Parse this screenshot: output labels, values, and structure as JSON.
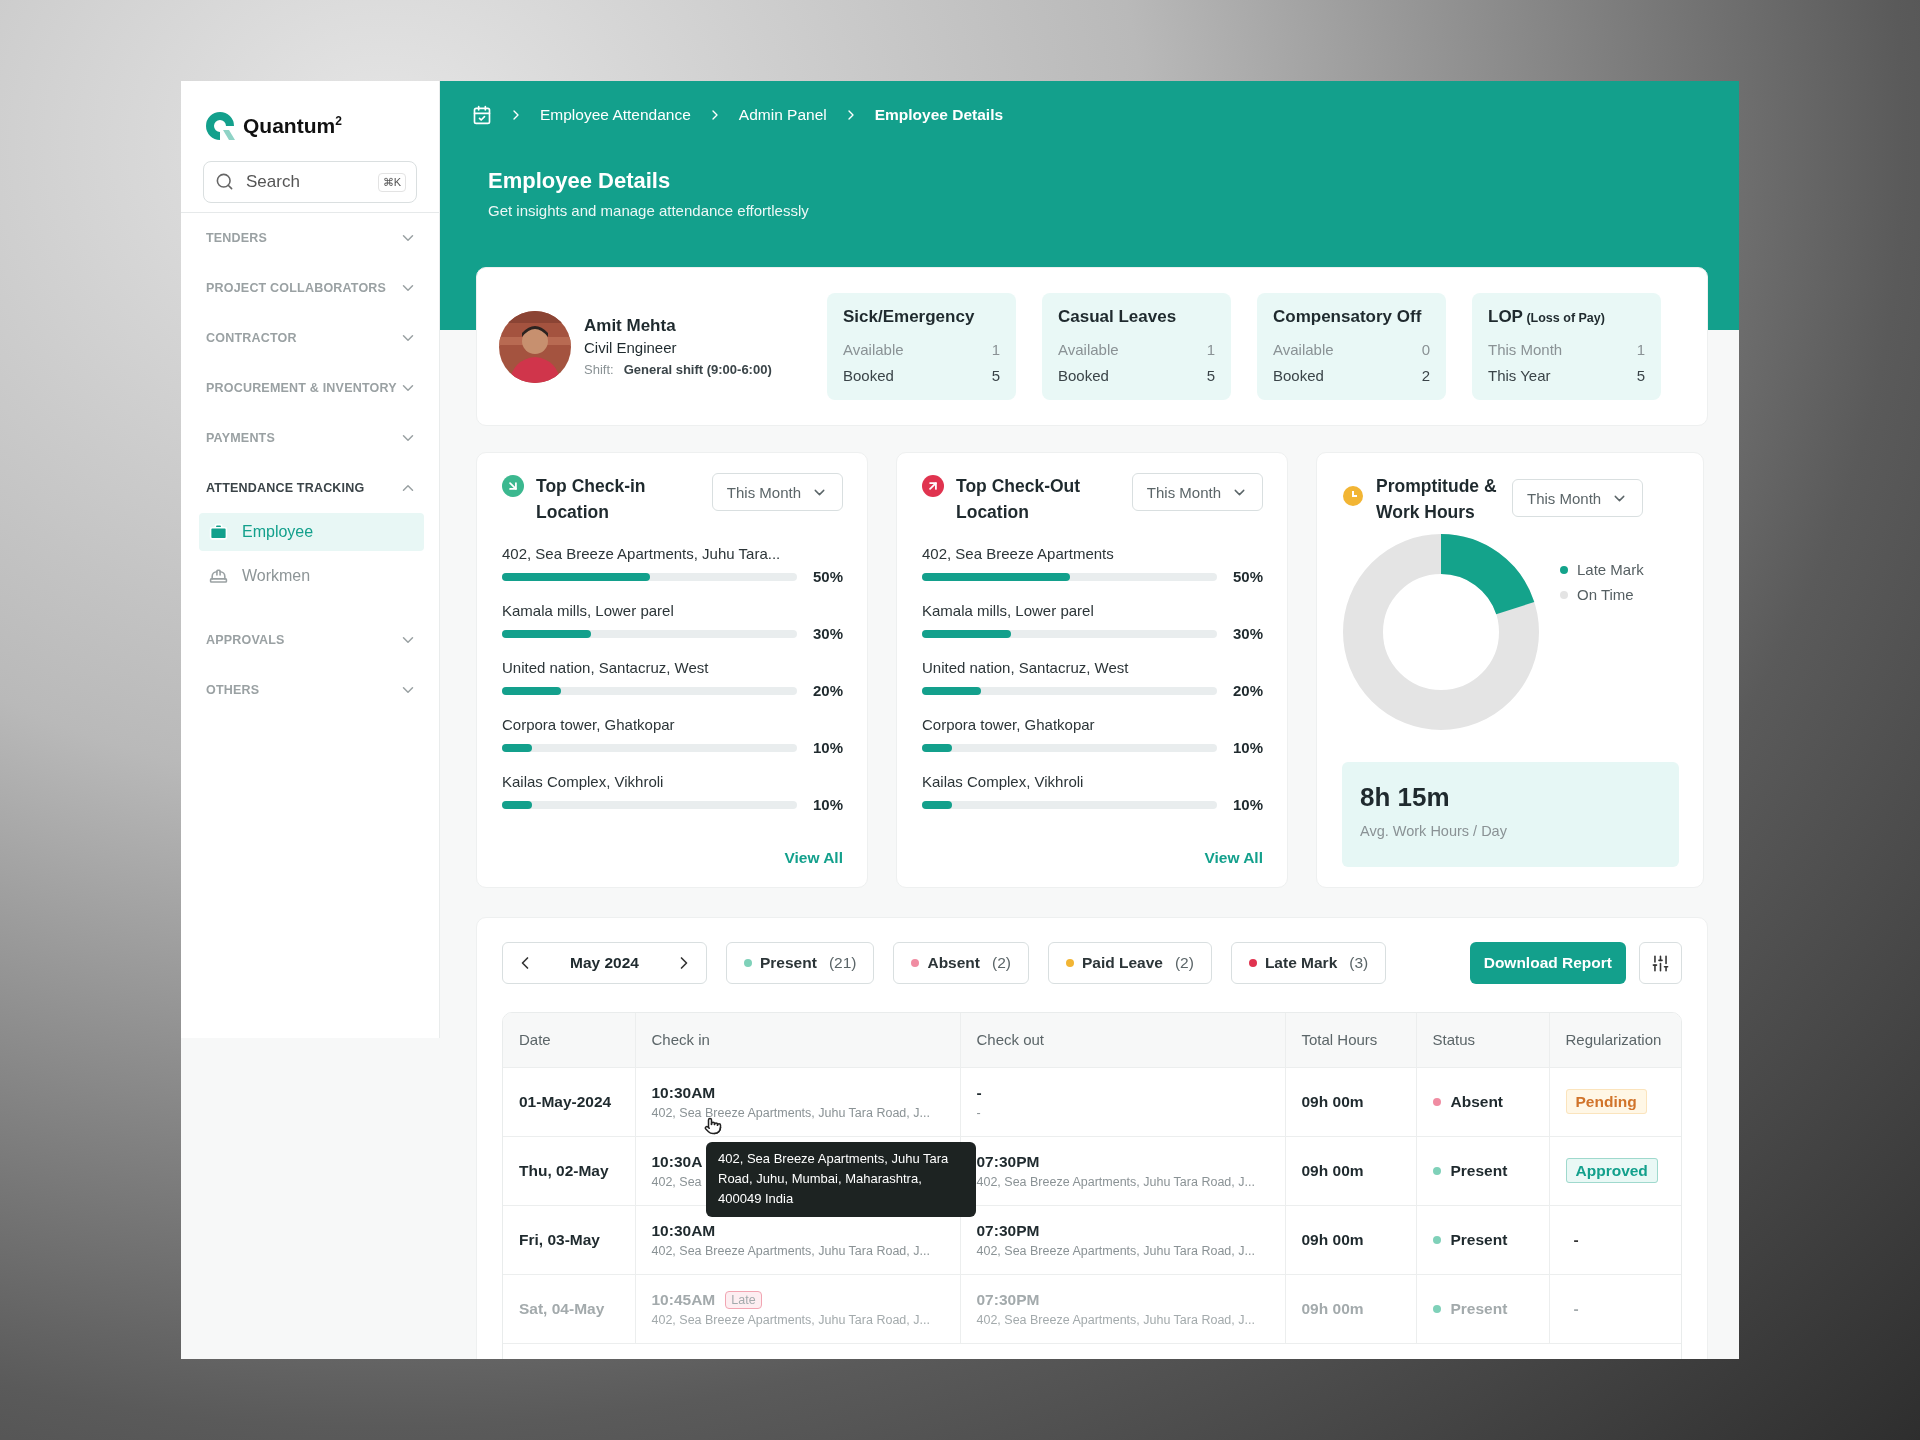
{
  "sidebar": {
    "logo": "Quantum$^{2}$",
    "search": {
      "placeholder": "Search",
      "shortcut": "⌘K"
    },
    "sections": [
      {
        "label": "TENDERS",
        "expanded": false
      },
      {
        "label": "PROJECT COLLABORATORS",
        "expanded": false
      },
      {
        "label": "CONTRACTOR",
        "expanded": false
      },
      {
        "label": "PROCUREMENT & INVENTORY",
        "expanded": false
      },
      {
        "label": "PAYMENTS",
        "expanded": false
      },
      {
        "label": "ATTENDANCE TRACKING",
        "expanded": true,
        "items": [
          {
            "label": "Employee",
            "kind": "employee",
            "selected": true
          },
          {
            "label": "Workmen",
            "kind": "workmen",
            "selected": false
          }
        ]
      },
      {
        "label": "APPROVALS",
        "expanded": false
      },
      {
        "label": "OTHERS",
        "expanded": false
      }
    ]
  },
  "breadcrumb": [
    {
      "label": "Employee Attendance",
      "current": false
    },
    {
      "label": "Admin Panel",
      "current": false
    },
    {
      "label": "Employee Details",
      "current": true
    }
  ],
  "header": {
    "title": "Employee Details",
    "subtitle": "Get insights and manage attendance effortlessly"
  },
  "employee": {
    "name": "Amit Mehta",
    "role": "Civil Engineer",
    "shift_label": "Shift:",
    "shift": "General shift (9:00-6:00)"
  },
  "leave_cards": [
    {
      "title": "Sick/Emergency",
      "rows": [
        {
          "label": "Available",
          "value": "1"
        },
        {
          "label": "Booked",
          "value": "5"
        }
      ]
    },
    {
      "title": "Casual Leaves",
      "rows": [
        {
          "label": "Available",
          "value": "1"
        },
        {
          "label": "Booked",
          "value": "5"
        }
      ]
    },
    {
      "title": "Compensatory Off",
      "rows": [
        {
          "label": "Available",
          "value": "0"
        },
        {
          "label": "Booked",
          "value": "2"
        }
      ]
    },
    {
      "title": "LOP",
      "note": "(Loss of Pay)",
      "rows": [
        {
          "label": "This Month",
          "value": "1"
        },
        {
          "label": "This Year",
          "value": "5"
        }
      ]
    }
  ],
  "location_panels": [
    {
      "kind": "checkin",
      "title": "Top Check-in Location",
      "period": "This Month",
      "link": "View All",
      "locations": [
        {
          "name": "402, Sea Breeze Apartments, Juhu Tara...",
          "level": 0.5,
          "percent": "50%"
        },
        {
          "name": "Kamala mills, Lower parel",
          "level": 0.3,
          "percent": "30%"
        },
        {
          "name": "United nation, Santacruz, West",
          "level": 0.2,
          "percent": "20%"
        },
        {
          "name": "Corpora tower, Ghatkopar",
          "level": 0.1,
          "percent": "10%"
        },
        {
          "name": "Kailas Complex, Vikhroli",
          "level": 0.1,
          "percent": "10%"
        }
      ]
    },
    {
      "kind": "checkout",
      "title": "Top Check-Out Location",
      "period": "This Month",
      "link": "View All",
      "locations": [
        {
          "name": "402, Sea Breeze Apartments",
          "level": 0.5,
          "percent": "50%"
        },
        {
          "name": "Kamala mills, Lower parel",
          "level": 0.3,
          "percent": "30%"
        },
        {
          "name": "United nation, Santacruz, West",
          "level": 0.2,
          "percent": "20%"
        },
        {
          "name": "Corpora tower, Ghatkopar",
          "level": 0.1,
          "percent": "10%"
        },
        {
          "name": "Kailas Complex, Vikhroli",
          "level": 0.1,
          "percent": "10%"
        }
      ]
    }
  ],
  "promptitude": {
    "title": "Promptitude & Work Hours",
    "period": "This Month",
    "legend": [
      {
        "label": "Late Mark",
        "color": "#14a38b"
      },
      {
        "label": "On Time",
        "color": "#e4e4e4"
      }
    ],
    "avg_value": "8h 15m",
    "avg_label": "Avg. Work Hours / Day"
  },
  "attendance": {
    "month": "May 2024",
    "filters": [
      {
        "label": "Present",
        "count": "(21)",
        "color": "#7fd1b9"
      },
      {
        "label": "Absent",
        "count": "(2)",
        "color": "#f08ca2"
      },
      {
        "label": "Paid Leave",
        "count": "(2)",
        "color": "#f2b534"
      },
      {
        "label": "Late Mark",
        "count": "(3)",
        "color": "#e0334f"
      }
    ],
    "download": "Download Report",
    "columns": [
      "Date",
      "Check in",
      "Check out",
      "Total Hours",
      "Status",
      "Regularization"
    ],
    "rows": [
      {
        "date": "01-May-2024",
        "check_in": {
          "time": "10:30AM",
          "address": "402, Sea Breeze Apartments, Juhu Tara Road, J..."
        },
        "check_out": {
          "time": "-",
          "address": "-"
        },
        "total": "09h 00m",
        "status": {
          "label": "Absent",
          "color": "#f08ca2"
        },
        "regularization": {
          "label": "Pending",
          "kind": "pending"
        }
      },
      {
        "date": "Thu, 02-May",
        "check_in": {
          "time": "10:30A",
          "address": "402, Sea"
        },
        "check_out": {
          "time": "07:30PM",
          "address": "402, Sea Breeze Apartments, Juhu Tara Road, J..."
        },
        "total": "09h 00m",
        "status": {
          "label": "Present",
          "color": "#7fd1b9"
        },
        "regularization": {
          "label": "Approved",
          "kind": "approved"
        }
      },
      {
        "date": "Fri, 03-May",
        "check_in": {
          "time": "10:30AM",
          "address": "402, Sea Breeze Apartments, Juhu Tara Road, J..."
        },
        "check_out": {
          "time": "07:30PM",
          "address": "402, Sea Breeze Apartments, Juhu Tara Road, J..."
        },
        "total": "09h 00m",
        "status": {
          "label": "Present",
          "color": "#7fd1b9"
        },
        "regularization": {
          "label": "-",
          "kind": "none"
        }
      },
      {
        "date": "Sat, 04-May",
        "check_in": {
          "time": "10:45AM",
          "late": "Late",
          "address": "402, Sea Breeze Apartments, Juhu Tara Road, J..."
        },
        "check_out": {
          "time": "07:30PM",
          "address": "402, Sea Breeze Apartments, Juhu Tara Road, J..."
        },
        "total": "09h 00m",
        "status": {
          "label": "Present",
          "color": "#7fd1b9"
        },
        "regularization": {
          "label": "-",
          "kind": "none"
        }
      }
    ],
    "tooltip": "402, Sea Breeze Apartments, Juhu Tara Road, Juhu, Mumbai, Maharashtra, 400049 India"
  }
}
